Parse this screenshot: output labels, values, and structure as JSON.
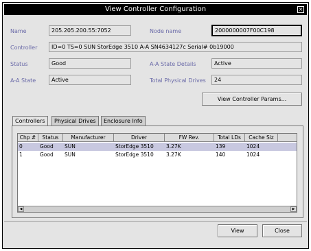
{
  "window": {
    "title": "View Controller Configuration",
    "close_glyph": "×"
  },
  "fields": {
    "name_label": "Name",
    "name_value": "205.205.200.55:7052",
    "node_name_label": "Node name",
    "node_name_value": "2000000007F00C198",
    "controller_label": "Controller",
    "controller_value": "ID=0  TS=0  SUN StorEdge 3510 A-A  SN4634127c  Serial# 0b19000",
    "status_label": "Status",
    "status_value": "Good",
    "aa_state_details_label": "A-A State Details",
    "aa_state_details_value": "Active",
    "aa_state_label": "A-A State",
    "aa_state_value": "Active",
    "total_physical_drives_label": "Total Physical Drives",
    "total_physical_drives_value": "24"
  },
  "buttons": {
    "view_controller_params": "View Controller Params...",
    "view": "View",
    "close": "Close"
  },
  "tabs": [
    {
      "label": "Controllers"
    },
    {
      "label": "Physical Drives"
    },
    {
      "label": "Enclosure Info"
    }
  ],
  "table": {
    "columns": [
      "Chp #",
      "Status",
      "Manufacturer",
      "Driver",
      "FW Rev.",
      "Total LDs",
      "Cache Siz"
    ],
    "rows": [
      [
        "0",
        "Good",
        "SUN",
        "StorEdge 3510",
        "3.27K",
        "139",
        "1024"
      ],
      [
        "1",
        "Good",
        "SUN",
        "StorEdge 3510",
        "3.27K",
        "140",
        "1024"
      ]
    ]
  }
}
